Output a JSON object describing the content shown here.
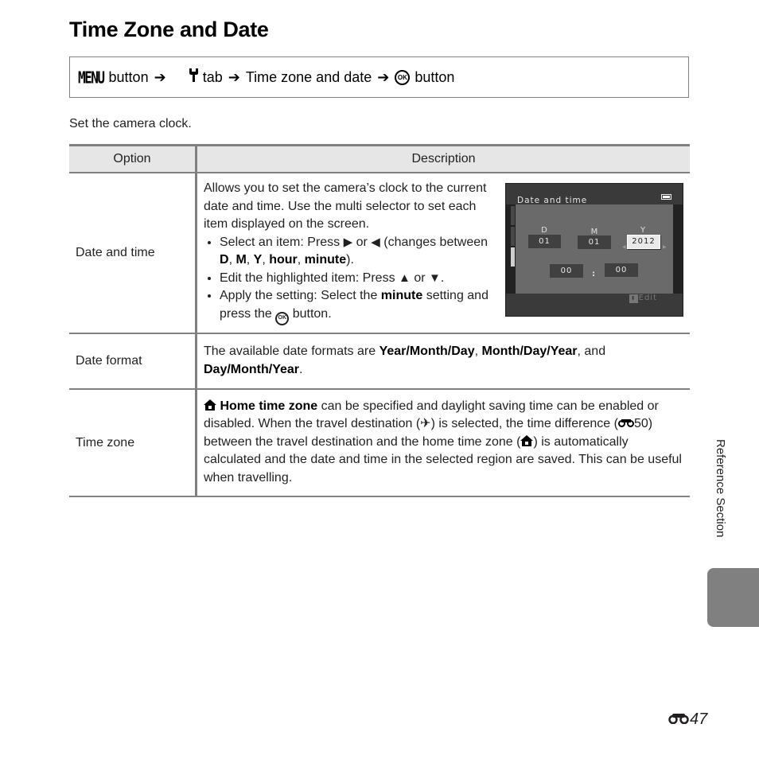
{
  "page": {
    "title": "Time Zone and Date",
    "intro": "Set the camera clock.",
    "section_label": "Reference Section",
    "page_number": "47",
    "page_prefix_icon": "reference-binoculars-icon"
  },
  "nav": {
    "menu_label": "MENU",
    "button_word_1": "button",
    "arrow": "➔",
    "tab_icon": "wrench-icon",
    "tab_word": "tab",
    "item": "Time zone and date",
    "ok_label": "OK",
    "button_word_2": "button"
  },
  "table": {
    "headers": [
      "Option",
      "Description"
    ],
    "rows": [
      {
        "option": "Date and time",
        "intro": "Allows you to set the camera’s clock to the current date and time. Use the multi selector to set each item displayed on the screen.",
        "bullets": [
          {
            "pre": "Select an item: Press ",
            "sym1": "▶",
            "mid": " or ",
            "sym2": "◀",
            "post": " (changes between ",
            "b1": "D",
            "b2": "M",
            "b3": "Y",
            "b4": "hour",
            "b5": "minute",
            "end": ")."
          },
          {
            "pre": "Edit the highlighted item: Press ",
            "sym1": "▲",
            "mid": " or ",
            "sym2": "▼",
            "post": "."
          },
          {
            "pre": "Apply the setting: Select the ",
            "bold": "minute",
            "post": " setting and press the ",
            "ok": "OK",
            "end": " button."
          }
        ],
        "screen": {
          "title": "Date and time",
          "labels": [
            "D",
            "M",
            "Y"
          ],
          "day": "01",
          "month": "01",
          "year": "2012",
          "hour": "00",
          "minute": "00",
          "colon": ":",
          "edit_label": "Edit",
          "selected_field": "year"
        }
      },
      {
        "option": "Date format",
        "pre": "The available date formats are ",
        "f1": "Year/Month/Day",
        "sep1": ", ",
        "f2": "Month/Day/Year",
        "sep2": ", and ",
        "f3": "Day/Month/Year",
        "end": "."
      },
      {
        "option": "Time zone",
        "bold_lead": "Home time zone",
        "t1": " can be specified and daylight saving time can be enabled or disabled. When the travel destination (",
        "t2": ") is selected, the time difference (",
        "ref": "50",
        "t3": ") between the travel destination and the home time zone (",
        "t4": ") is automatically calculated and the date and time in the selected region are saved. This can be useful when travelling."
      }
    ]
  }
}
